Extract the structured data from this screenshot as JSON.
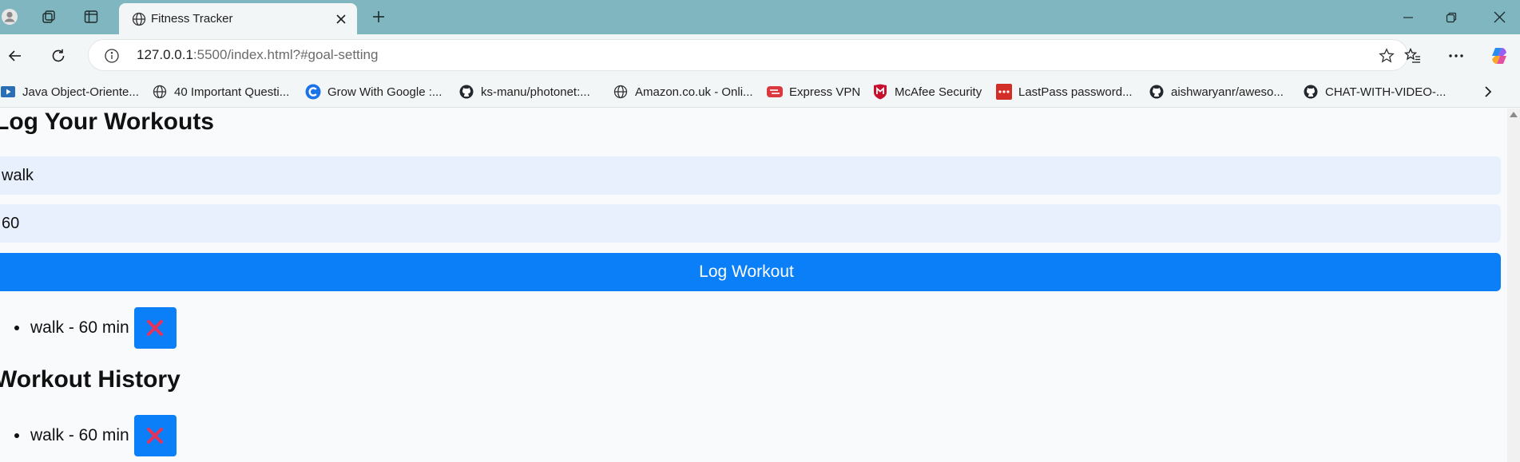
{
  "browser": {
    "tab_title": "Fitness Tracker",
    "url_host": "127.0.0.1",
    "url_rest": ":5500/index.html?#goal-setting",
    "bookmarks": [
      {
        "label": "Java Object-Oriente...",
        "icon": "bookmark-site-icon"
      },
      {
        "label": "40 Important Questi...",
        "icon": "globe-icon"
      },
      {
        "label": "Grow With Google :...",
        "icon": "grow-with-google-icon"
      },
      {
        "label": "ks-manu/photonet:...",
        "icon": "github-icon"
      },
      {
        "label": "Amazon.co.uk - Onli...",
        "icon": "globe-icon"
      },
      {
        "label": "Express VPN",
        "icon": "expressvpn-icon"
      },
      {
        "label": "McAfee Security",
        "icon": "mcafee-icon"
      },
      {
        "label": "LastPass password...",
        "icon": "lastpass-icon"
      },
      {
        "label": "aishwaryanr/aweso...",
        "icon": "github-icon"
      },
      {
        "label": "CHAT-WITH-VIDEO-...",
        "icon": "github-icon"
      }
    ]
  },
  "page": {
    "log_heading": "Log Your Workouts",
    "workout_input_value": "walk",
    "duration_input_value": "60",
    "log_button_label": "Log Workout",
    "current_workouts": [
      {
        "text": "walk - 60 min",
        "delete_label": "❌"
      }
    ],
    "history_heading": "Workout History",
    "history": [
      {
        "text": "walk - 60 min",
        "delete_label": "❌"
      }
    ]
  },
  "colors": {
    "titlebar": "#7fb6bf",
    "accent": "#0a7ff8",
    "input_bg": "#e8f0fe",
    "delete_icon": "#e8325a"
  }
}
